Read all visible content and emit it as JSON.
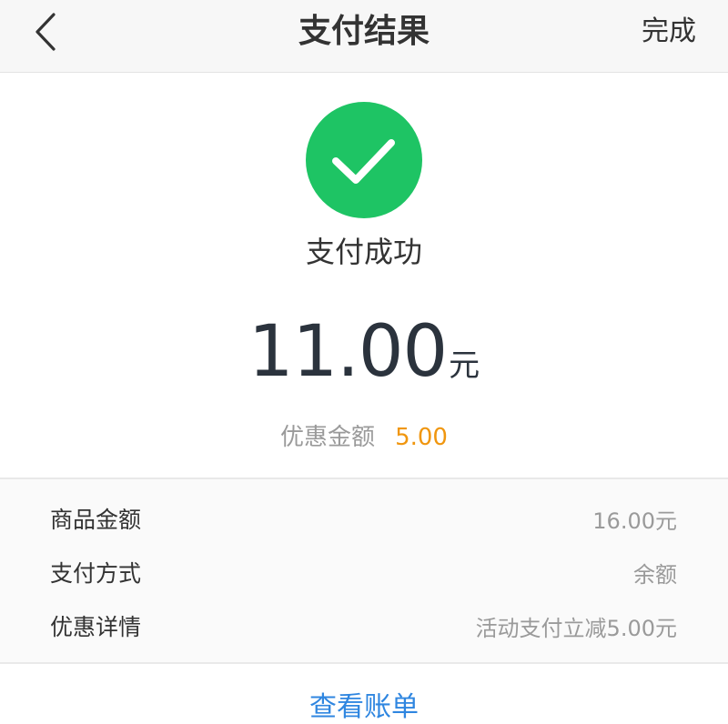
{
  "nav": {
    "title": "支付结果",
    "done_label": "完成",
    "back_icon": "chevron-left-icon"
  },
  "result": {
    "status_icon": "check-circle-icon",
    "status_text": "支付成功",
    "amount": "11.00",
    "amount_unit": "元",
    "discount_label": "优惠金额",
    "discount_value": "5.00",
    "success_color": "#1ec464",
    "discount_color": "#f0960f"
  },
  "details": [
    {
      "label": "商品金额",
      "value": "16.00元"
    },
    {
      "label": "支付方式",
      "value": "余额"
    },
    {
      "label": "优惠详情",
      "value": "活动支付立减5.00元"
    }
  ],
  "footer": {
    "bill_link": "查看账单",
    "link_color": "#2f86e0"
  }
}
